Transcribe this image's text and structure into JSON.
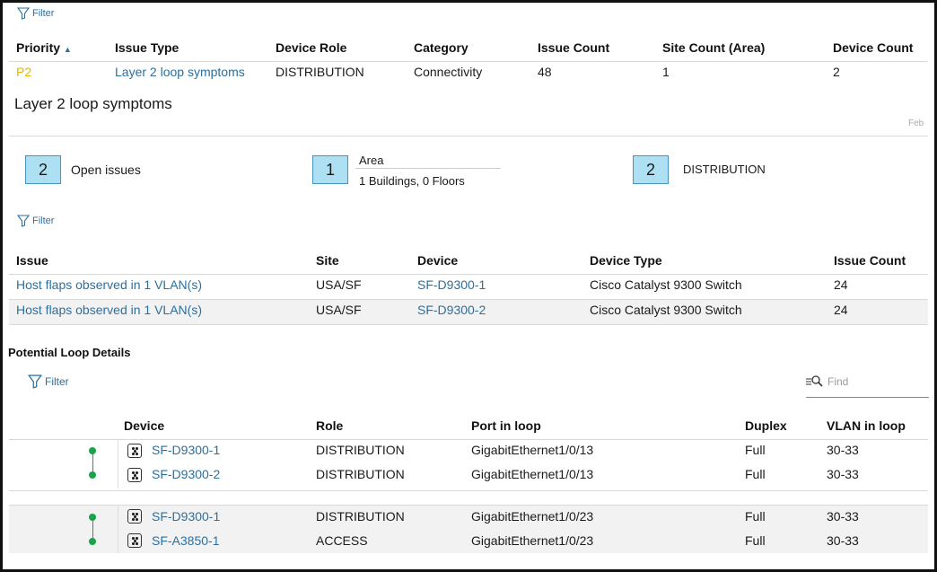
{
  "filter_label": "Filter",
  "issue_table": {
    "columns": [
      "Priority",
      "Issue Type",
      "Device Role",
      "Category",
      "Issue Count",
      "Site Count (Area)",
      "Device Count"
    ],
    "sort_indicator": "▲",
    "row": {
      "priority": "P2",
      "issue_type": "Layer 2 loop symptoms",
      "device_role": "DISTRIBUTION",
      "category": "Connectivity",
      "issue_count": "48",
      "site_count": "1",
      "device_count": "2"
    }
  },
  "detail": {
    "title": "Layer 2 loop symptoms",
    "timeline_label": "Feb"
  },
  "stats": {
    "open_issues": {
      "value": "2",
      "label": "Open issues"
    },
    "area": {
      "value": "1",
      "label": "Area",
      "sub": "1 Buildings, 0 Floors"
    },
    "role": {
      "value": "2",
      "label": "DISTRIBUTION"
    }
  },
  "issues_table": {
    "columns": [
      "Issue",
      "Site",
      "Device",
      "Device Type",
      "Issue Count"
    ],
    "rows": [
      {
        "issue": "Host flaps observed in 1 VLAN(s)",
        "site": "USA/SF",
        "device": "SF-D9300-1",
        "device_type": "Cisco Catalyst 9300 Switch",
        "count": "24"
      },
      {
        "issue": "Host flaps observed in 1 VLAN(s)",
        "site": "USA/SF",
        "device": "SF-D9300-2",
        "device_type": "Cisco Catalyst 9300 Switch",
        "count": "24"
      }
    ]
  },
  "loop": {
    "title": "Potential Loop Details",
    "find_placeholder": "Find",
    "columns": [
      "Device",
      "Role",
      "Port in loop",
      "Duplex",
      "VLAN in loop"
    ],
    "groups": [
      [
        {
          "device": "SF-D9300-1",
          "role": "DISTRIBUTION",
          "port": "GigabitEthernet1/0/13",
          "duplex": "Full",
          "vlan": "30-33"
        },
        {
          "device": "SF-D9300-2",
          "role": "DISTRIBUTION",
          "port": "GigabitEthernet1/0/13",
          "duplex": "Full",
          "vlan": "30-33"
        }
      ],
      [
        {
          "device": "SF-D9300-1",
          "role": "DISTRIBUTION",
          "port": "GigabitEthernet1/0/23",
          "duplex": "Full",
          "vlan": "30-33"
        },
        {
          "device": "SF-A3850-1",
          "role": "ACCESS",
          "port": "GigabitEthernet1/0/23",
          "duplex": "Full",
          "vlan": "30-33"
        }
      ]
    ]
  },
  "colors": {
    "link": "#2d6f9e",
    "priority_p2": "#e0b800",
    "stat_box": "#aee0f3",
    "loop_dot": "#1aa34a",
    "row_alt": "#f2f2f2"
  }
}
